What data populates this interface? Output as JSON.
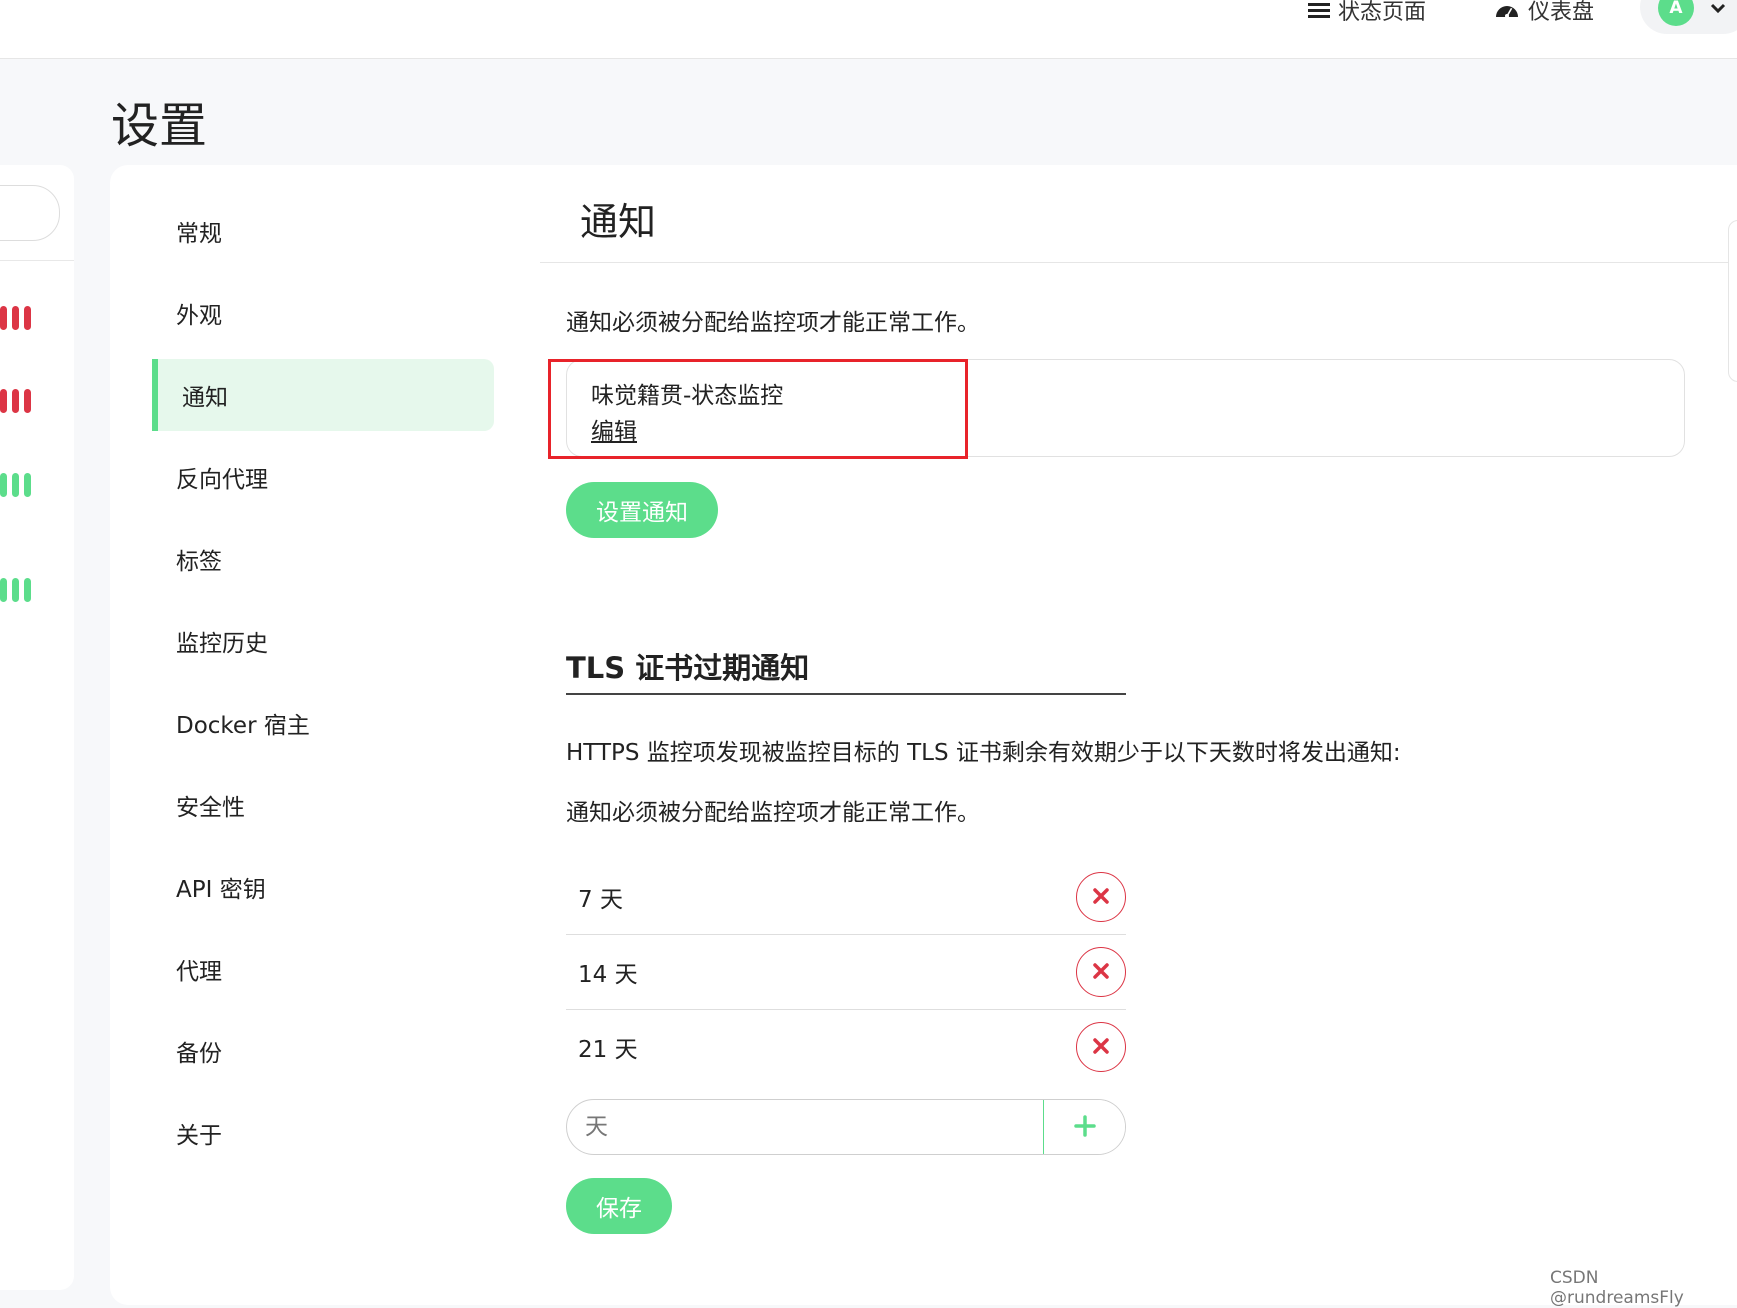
{
  "header": {
    "status_page_label": "状态页面",
    "dashboard_label": "仪表盘",
    "avatar_letter": "A"
  },
  "page": {
    "title": "设置"
  },
  "sidebar": {
    "items": [
      {
        "label": "常规",
        "active": false
      },
      {
        "label": "外观",
        "active": false
      },
      {
        "label": "通知",
        "active": true
      },
      {
        "label": "反向代理",
        "active": false
      },
      {
        "label": "标签",
        "active": false
      },
      {
        "label": "监控历史",
        "active": false
      },
      {
        "label": "Docker 宿主",
        "active": false
      },
      {
        "label": "安全性",
        "active": false
      },
      {
        "label": "API 密钥",
        "active": false
      },
      {
        "label": "代理",
        "active": false
      },
      {
        "label": "备份",
        "active": false
      },
      {
        "label": "关于",
        "active": false
      }
    ]
  },
  "main": {
    "section_title": "通知",
    "intro": "通知必须被分配给监控项才能正常工作。",
    "notification": {
      "name": "味觉籍贯-状态监控",
      "edit_label": "编辑"
    },
    "setup_button": "设置通知",
    "tls": {
      "title": "TLS 证书过期通知",
      "description": "HTTPS 监控项发现被监控目标的 TLS 证书剩余有效期少于以下天数时将发出通知:",
      "note": "通知必须被分配给监控项才能正常工作。",
      "days": [
        "7 天",
        "14 天",
        "21 天"
      ],
      "input_placeholder": "天"
    },
    "save_button": "保存"
  },
  "colors": {
    "accent": "#5cdd8b",
    "active_bg": "#e6f8ec",
    "danger": "#dc3545",
    "highlight_border": "#e8232a"
  },
  "left_monitor_heartbeats": [
    "down",
    "down",
    "up",
    "up"
  ],
  "watermark": "CSDN @rundreamsFly"
}
